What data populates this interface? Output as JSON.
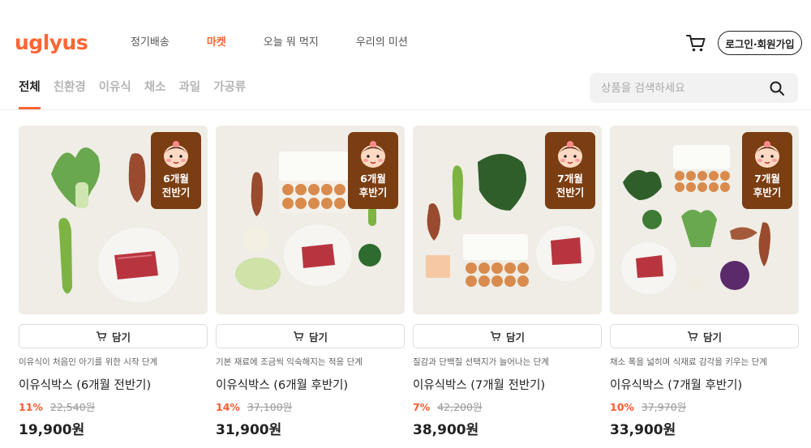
{
  "header": {
    "logo": "uglyus",
    "nav": [
      "정기배송",
      "마켓",
      "오늘 뭐 먹지",
      "우리의 미션"
    ],
    "active_nav": 1,
    "login_label": "로그인·회원가입",
    "cart_icon": "cart-icon"
  },
  "categories": {
    "tabs": [
      "전체",
      "친환경",
      "이유식",
      "채소",
      "과일",
      "가공류"
    ],
    "active": 0
  },
  "search": {
    "placeholder": "상품을 검색하세요",
    "icon": "search-icon"
  },
  "colors": {
    "accent": "#ff6634",
    "badge": "#7a3e12",
    "discount": "#ff5a2e"
  },
  "products": [
    {
      "badge": "6개월\n전반기",
      "add_label": "담기",
      "description": "이유식이 처음인 아기를 위한 시작 단계",
      "name": "이유식박스 (6개월 전반기)",
      "discount": "11%",
      "original_price": "22,540원",
      "price": "19,900원"
    },
    {
      "badge": "6개월\n후반기",
      "add_label": "담기",
      "description": "기본 재료에 조금씩 익숙해지는 적응 단계",
      "name": "이유식박스 (6개월 후반기)",
      "discount": "14%",
      "original_price": "37,100원",
      "price": "31,900원"
    },
    {
      "badge": "7개월\n전반기",
      "add_label": "담기",
      "description": "질감과 단백질 선택지가 늘어나는 단계",
      "name": "이유식박스 (7개월 전반기)",
      "discount": "7%",
      "original_price": "42,200원",
      "price": "38,900원"
    },
    {
      "badge": "7개월\n후반기",
      "add_label": "담기",
      "description": "채소 폭을 넓히며 식재료 감각을 키우는 단계",
      "name": "이유식박스 (7개월 후반기)",
      "discount": "10%",
      "original_price": "37,970원",
      "price": "33,900원"
    }
  ]
}
